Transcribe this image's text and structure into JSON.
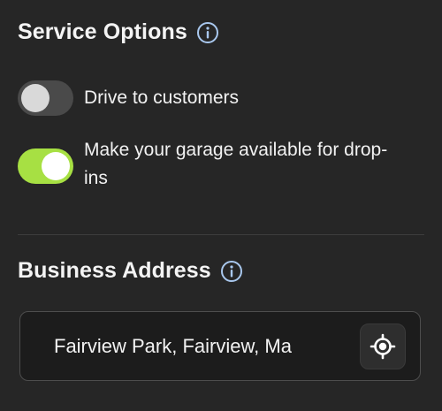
{
  "service_options": {
    "title": "Service Options",
    "info_icon": "info-circle-icon",
    "options": [
      {
        "label": "Drive to customers",
        "enabled": false
      },
      {
        "label": "Make your garage available for drop-ins",
        "enabled": true
      }
    ]
  },
  "business_address": {
    "title": "Business Address",
    "info_icon": "info-circle-icon",
    "value": "Fairview Park, Fairview, Ma",
    "locate_icon": "crosshair-locate-icon"
  },
  "colors": {
    "background": "#262626",
    "toggle_on": "#a7e043",
    "toggle_off": "#4a4a4a",
    "info_icon": "#a9c8ee"
  }
}
